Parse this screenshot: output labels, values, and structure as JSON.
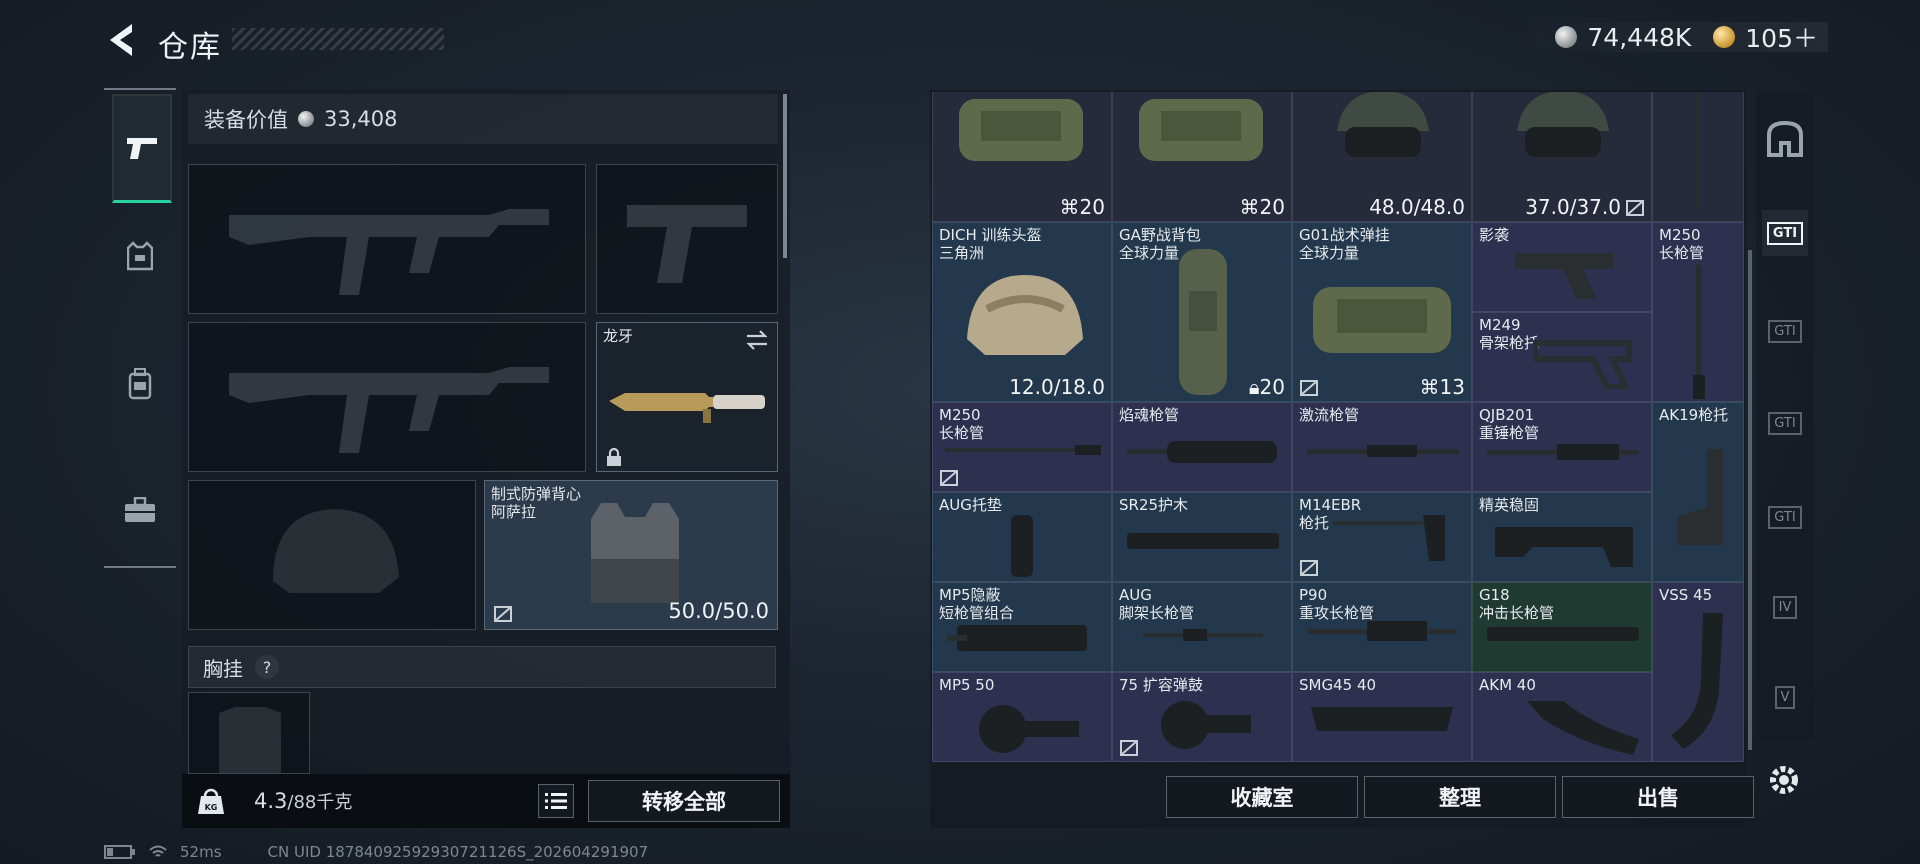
{
  "header": {
    "title": "仓库",
    "silver": "74,448K",
    "gold": "105＋"
  },
  "loadout": {
    "value_label": "装备价值",
    "value": "33,408",
    "knife": {
      "label": "龙牙"
    },
    "vest": {
      "label_line1": "制式防弹背心",
      "label_line2": "阿萨拉",
      "durability": "50.0/50.0"
    },
    "chest_label": "胸挂",
    "help": "?",
    "weight": "4.3",
    "weight_unit": "/88千克",
    "transfer_all": "转移全部"
  },
  "stash": {
    "cells": [
      {
        "id": "c1",
        "line1": "",
        "line2": "",
        "value": "⌘20"
      },
      {
        "id": "c2",
        "line1": "",
        "line2": "",
        "value": "⌘20"
      },
      {
        "id": "c3",
        "line1": "",
        "line2": "",
        "value": "48.0/48.0"
      },
      {
        "id": "c4",
        "line1": "",
        "line2": "",
        "value": "37.0/37.0"
      },
      {
        "id": "c6",
        "line1": "DICH 训练头盔",
        "line2": "三角洲",
        "value": "12.0/18.0"
      },
      {
        "id": "c7",
        "line1": "GA野战背包",
        "line2": "全球力量",
        "value": "20"
      },
      {
        "id": "c8",
        "line1": "G01战术弹挂",
        "line2": "全球力量",
        "value": "13"
      },
      {
        "id": "c9",
        "line1": "影袭",
        "line2": "",
        "value": ""
      },
      {
        "id": "c9b",
        "line1": "M249",
        "line2": "骨架枪托",
        "value": ""
      },
      {
        "id": "c10",
        "line1": "M250",
        "line2": "长枪管",
        "value": ""
      },
      {
        "id": "c11",
        "line1": "M250",
        "line2": "长枪管",
        "value": ""
      },
      {
        "id": "c12",
        "line1": "焰魂枪管",
        "line2": "",
        "value": ""
      },
      {
        "id": "c13",
        "line1": "激流枪管",
        "line2": "",
        "value": ""
      },
      {
        "id": "c14",
        "line1": "QJB201",
        "line2": "重锤枪管",
        "value": ""
      },
      {
        "id": "c15",
        "line1": "AK19枪托",
        "line2": "",
        "value": ""
      },
      {
        "id": "c16",
        "line1": "AUG托垫",
        "line2": "",
        "value": ""
      },
      {
        "id": "c17",
        "line1": "SR25护木",
        "line2": "",
        "value": ""
      },
      {
        "id": "c18",
        "line1": "M14EBR",
        "line2": "枪托",
        "value": ""
      },
      {
        "id": "c19",
        "line1": "精英稳固",
        "line2": "",
        "value": ""
      },
      {
        "id": "c20",
        "line1": "MP5隐蔽",
        "line2": "短枪管组合",
        "value": ""
      },
      {
        "id": "c21",
        "line1": "AUG",
        "line2": "脚架长枪管",
        "value": ""
      },
      {
        "id": "c22",
        "line1": "P90",
        "line2": "重攻长枪管",
        "value": ""
      },
      {
        "id": "c23",
        "line1": "G18",
        "line2": "冲击长枪管",
        "value": ""
      },
      {
        "id": "c24",
        "line1": "VSS 45",
        "line2": "",
        "value": ""
      },
      {
        "id": "c25",
        "line1": "MP5 50",
        "line2": "",
        "value": ""
      },
      {
        "id": "c26",
        "line1": "75 扩容弹鼓",
        "line2": "",
        "value": ""
      },
      {
        "id": "c27",
        "line1": "SMG45 40",
        "line2": "",
        "value": ""
      },
      {
        "id": "c28",
        "line1": "AKM 40",
        "line2": "",
        "value": ""
      }
    ],
    "buttons": {
      "collection": "收藏室",
      "sort": "整理",
      "sell": "出售"
    }
  },
  "right_tabs": [
    "GTI",
    "GTI",
    "GTI",
    "GTI",
    "IV",
    "V"
  ],
  "status": {
    "ping": "52ms",
    "uid": "CN UID 18784092592930721126S_202604291907"
  },
  "colors": {
    "accent": "#29d3a0",
    "purple": "#2e3050",
    "blue": "#23384c",
    "green": "#1f3a30"
  }
}
